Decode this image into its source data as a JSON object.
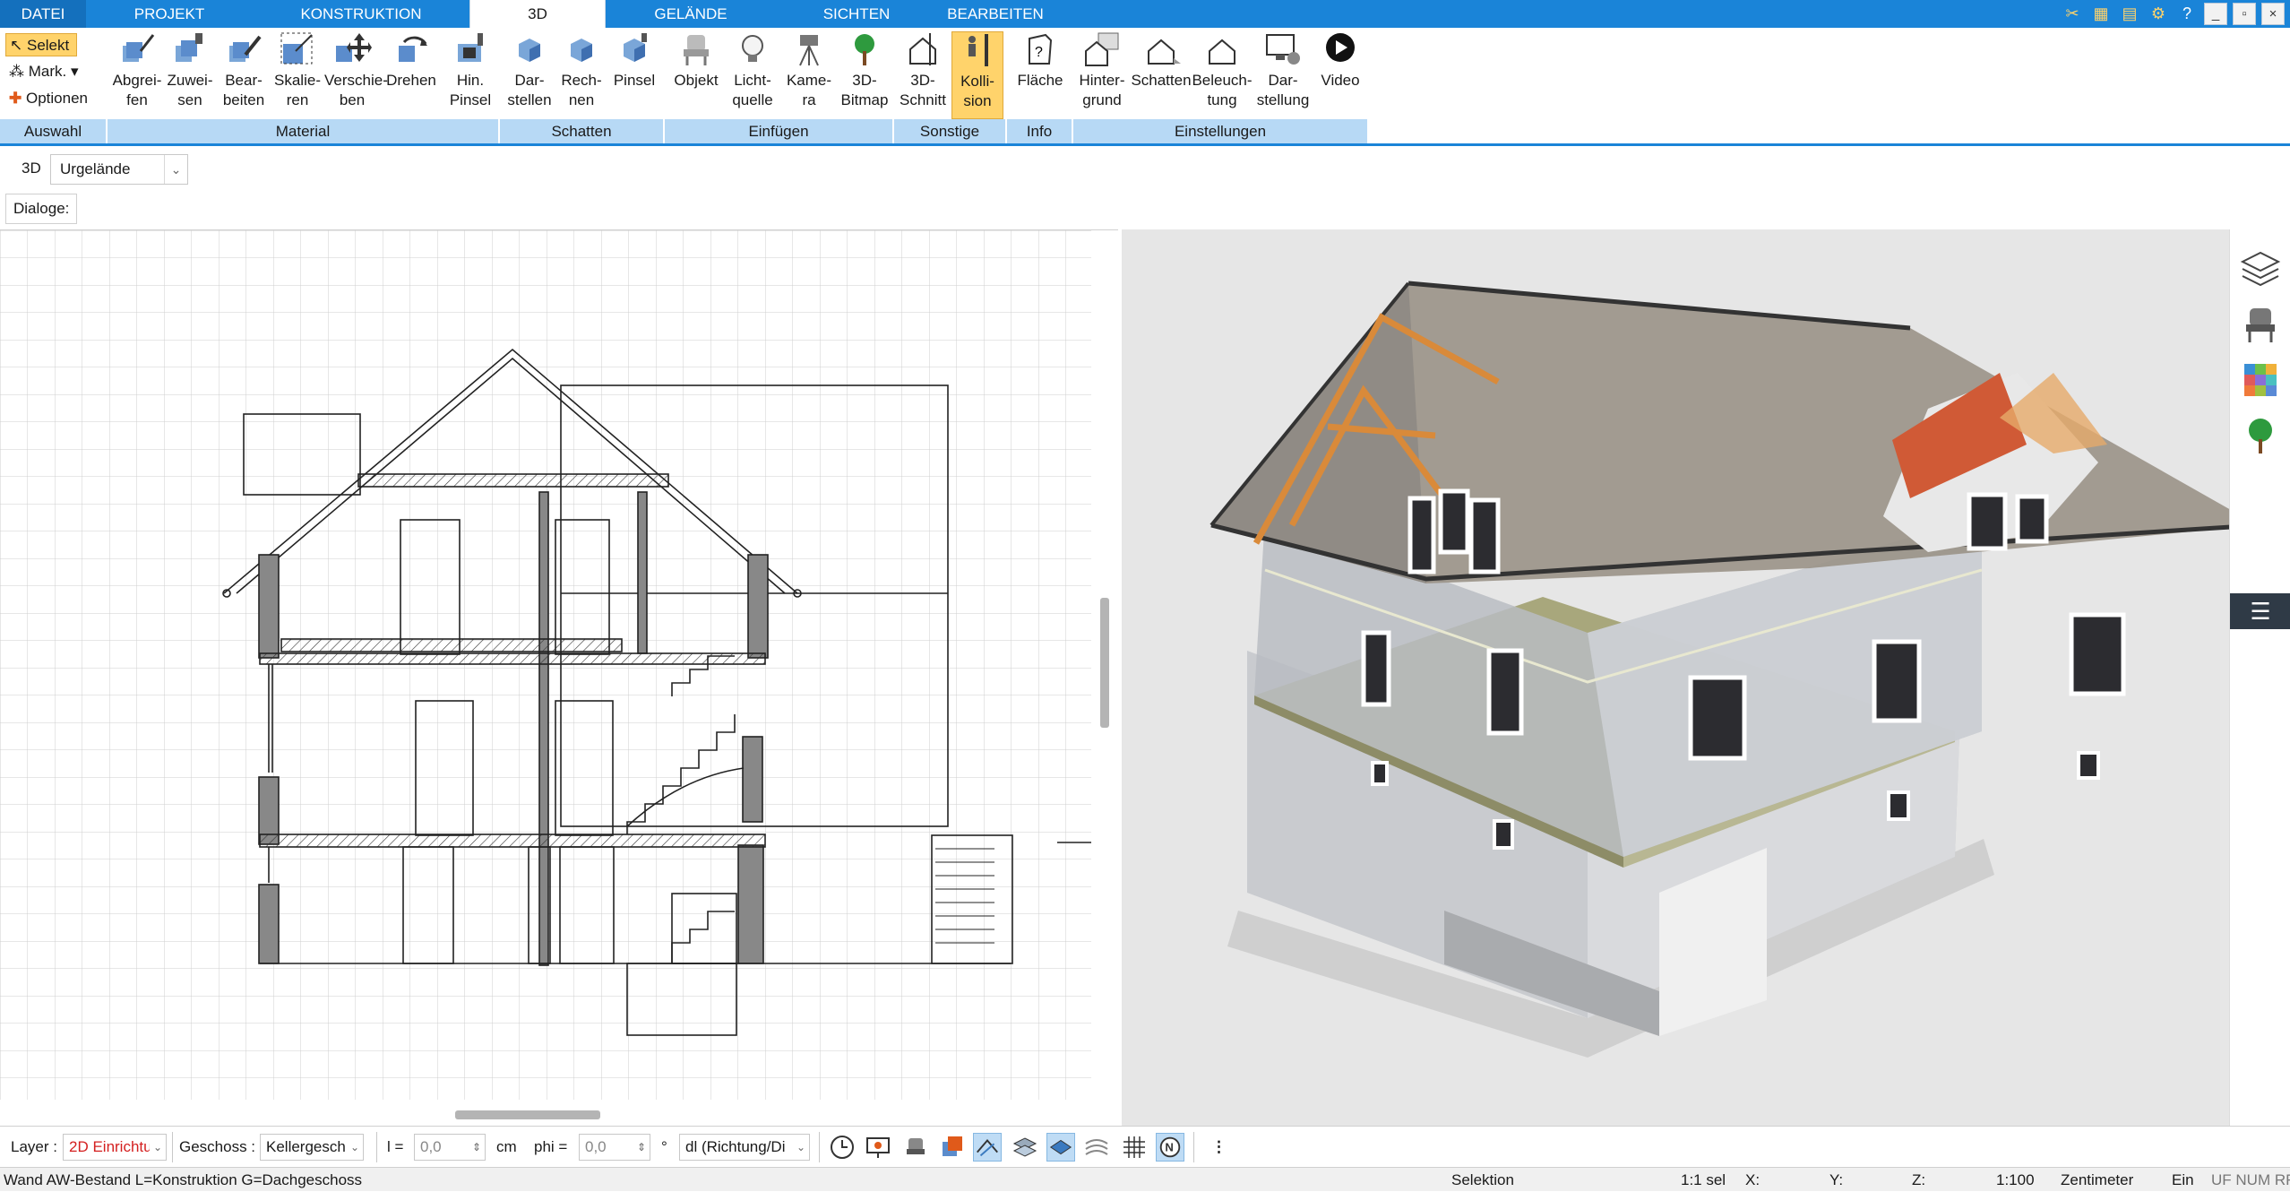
{
  "menu": {
    "tabs": [
      "DATEI",
      "PROJEKT",
      "KONSTRUKTION",
      "3D",
      "GELÄNDE",
      "SICHTEN",
      "BEARBEITEN"
    ],
    "active": "3D"
  },
  "window_buttons": [
    "_",
    "▫",
    "×"
  ],
  "ribbon": {
    "auswahl": {
      "select": "Selekt",
      "mark": "Mark.",
      "options": "Optionen",
      "group": "Auswahl"
    },
    "material": {
      "group": "Material",
      "buttons": [
        "Abgrei-\nfen",
        "Zuwei-\nsen",
        "Bear-\nbeiten",
        "Skalie-\nren",
        "Verschie-\nben",
        "Drehen",
        "Hin.\nPinsel"
      ]
    },
    "schatten": {
      "group": "Schatten",
      "buttons": [
        "Dar-\nstellen",
        "Rech-\nnen",
        "Pinsel"
      ]
    },
    "einfuegen": {
      "group": "Einfügen",
      "buttons": [
        "Objekt",
        "Licht-\nquelle",
        "Kame-\nra",
        "3D-\nBitmap"
      ]
    },
    "sonstige": {
      "group": "Sonstige",
      "buttons": [
        "3D-\nSchnitt",
        "Kolli-\nsion"
      ]
    },
    "info": {
      "group": "Info",
      "buttons": [
        "Fläche"
      ]
    },
    "einstellungen": {
      "group": "Einstellungen",
      "buttons": [
        "Hinter-\ngrund",
        "Schatten",
        "Beleuch-\ntung",
        "Dar-\nstellung",
        "Video"
      ]
    }
  },
  "row3d": {
    "label": "3D",
    "combo": "Urgelände"
  },
  "dialog": {
    "label": "Dialoge:"
  },
  "toolbar": {
    "layer_label": "Layer :",
    "layer_value": "2D Einrichtu",
    "geschoss_label": "Geschoss :",
    "geschoss_value": "Kellergesch",
    "l_label": "l =",
    "l_value": "0,0",
    "l_unit": "cm",
    "phi_label": "phi =",
    "phi_value": "0,0",
    "phi_unit": "°",
    "direction": "dl (Richtung/Di"
  },
  "status": {
    "left": "Wand AW-Bestand L=Konstruktion G=Dachgeschoss",
    "mode": "Selektion",
    "sel": "1:1 sel",
    "x": "X:",
    "y": "Y:",
    "z": "Z:",
    "scale": "1:100",
    "unit": "Zentimeter",
    "ein": "Ein",
    "flags": "UF NUM RF"
  },
  "colors": {
    "accent": "#1a84d8",
    "group_bg": "#b7d9f5",
    "active_btn": "#ffd36b",
    "layer_value": "#d42020"
  }
}
